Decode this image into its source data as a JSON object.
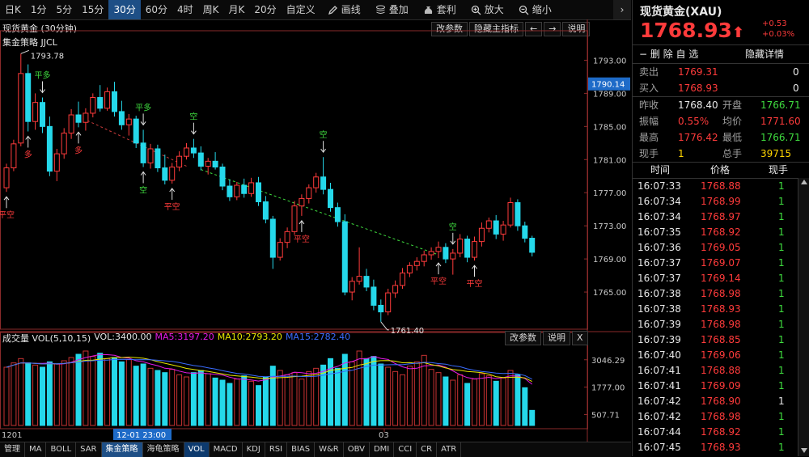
{
  "toolbar": {
    "periods": [
      "日K",
      "1分",
      "5分",
      "15分",
      "30分",
      "60分",
      "4时",
      "周K",
      "月K",
      "20分",
      "自定义"
    ],
    "active_period": "30分",
    "tools": [
      {
        "label": "画线",
        "icon": "pencil-icon"
      },
      {
        "label": "叠加",
        "icon": "stack-icon"
      },
      {
        "label": "套利",
        "icon": "money-bag-icon"
      },
      {
        "label": "放大",
        "icon": "zoom-in-icon"
      },
      {
        "label": "缩小",
        "icon": "zoom-out-icon"
      }
    ],
    "collapse": "›"
  },
  "chart_header": {
    "title": "现货黄金 (30分钟)",
    "strategy": "集金策略 JJCL",
    "buttons": [
      "改参数",
      "隐藏主指标",
      "←",
      "→",
      "说明"
    ]
  },
  "price_axis": {
    "ticks": [
      "1793.00",
      "1789.00",
      "1785.00",
      "1781.00",
      "1777.00",
      "1773.00",
      "1769.00",
      "1765.00"
    ],
    "current": "1790.14"
  },
  "annotations": {
    "high": "1793.78",
    "low": "1761.40"
  },
  "chart_data": [
    {
      "type": "candlestick",
      "title": "现货黄金 (30分钟)",
      "ylim": [
        1761,
        1795
      ],
      "x_labels": [
        "1201",
        "12-01 23:00",
        "03"
      ],
      "candles": [
        [
          1777.6,
          1780.5,
          1777.1,
          1780.0
        ],
        [
          1780.0,
          1783.4,
          1779.6,
          1782.9
        ],
        [
          1783.0,
          1793.8,
          1782.6,
          1791.4
        ],
        [
          1791.4,
          1792.5,
          1784.4,
          1785.6
        ],
        [
          1785.6,
          1789.0,
          1784.6,
          1787.9
        ],
        [
          1787.9,
          1788.5,
          1784.2,
          1785.0
        ],
        [
          1785.0,
          1786.2,
          1779.0,
          1779.6
        ],
        [
          1779.6,
          1782.3,
          1778.4,
          1781.7
        ],
        [
          1781.7,
          1784.8,
          1781.1,
          1784.2
        ],
        [
          1784.2,
          1787.1,
          1783.5,
          1786.4
        ],
        [
          1786.4,
          1788.0,
          1784.9,
          1785.5
        ],
        [
          1785.5,
          1787.2,
          1784.5,
          1786.6
        ],
        [
          1786.6,
          1789.0,
          1786.1,
          1788.5
        ],
        [
          1788.5,
          1790.0,
          1786.8,
          1787.2
        ],
        [
          1787.2,
          1789.7,
          1786.9,
          1789.2
        ],
        [
          1789.2,
          1790.4,
          1786.2,
          1786.8
        ],
        [
          1786.8,
          1788.1,
          1784.6,
          1785.2
        ],
        [
          1785.2,
          1786.5,
          1783.9,
          1785.9
        ],
        [
          1785.9,
          1786.3,
          1782.4,
          1783.0
        ],
        [
          1783.0,
          1784.6,
          1780.1,
          1780.6
        ],
        [
          1780.6,
          1782.9,
          1779.9,
          1782.3
        ],
        [
          1782.3,
          1782.8,
          1779.5,
          1780.0
        ],
        [
          1780.0,
          1781.6,
          1778.0,
          1778.5
        ],
        [
          1778.5,
          1780.6,
          1778.1,
          1780.1
        ],
        [
          1780.1,
          1782.0,
          1779.6,
          1781.4
        ],
        [
          1781.4,
          1783.0,
          1781.0,
          1782.4
        ],
        [
          1782.4,
          1783.5,
          1781.2,
          1781.8
        ],
        [
          1781.8,
          1782.6,
          1779.7,
          1780.2
        ],
        [
          1780.2,
          1781.2,
          1779.2,
          1780.8
        ],
        [
          1780.8,
          1781.9,
          1779.8,
          1780.1
        ],
        [
          1780.1,
          1780.5,
          1777.3,
          1777.8
        ],
        [
          1777.8,
          1778.6,
          1776.0,
          1776.5
        ],
        [
          1776.5,
          1778.3,
          1776.1,
          1777.9
        ],
        [
          1777.9,
          1778.7,
          1776.4,
          1776.9
        ],
        [
          1776.9,
          1778.8,
          1776.5,
          1778.2
        ],
        [
          1778.2,
          1778.9,
          1775.4,
          1775.9
        ],
        [
          1775.9,
          1776.6,
          1773.3,
          1773.8
        ],
        [
          1773.8,
          1774.2,
          1767.8,
          1769.2
        ],
        [
          1769.2,
          1771.5,
          1768.8,
          1771.0
        ],
        [
          1771.0,
          1772.8,
          1770.3,
          1772.3
        ],
        [
          1772.3,
          1776.0,
          1771.9,
          1775.4
        ],
        [
          1775.4,
          1776.8,
          1774.2,
          1776.3
        ],
        [
          1776.3,
          1778.0,
          1775.7,
          1777.6
        ],
        [
          1777.6,
          1779.4,
          1777.0,
          1778.9
        ],
        [
          1778.9,
          1781.3,
          1776.8,
          1777.4
        ],
        [
          1777.4,
          1778.2,
          1774.7,
          1775.2
        ],
        [
          1775.2,
          1775.8,
          1772.9,
          1773.5
        ],
        [
          1773.5,
          1774.4,
          1764.6,
          1765.0
        ],
        [
          1765.0,
          1766.8,
          1764.0,
          1766.3
        ],
        [
          1766.3,
          1770.4,
          1765.9,
          1766.9
        ],
        [
          1766.9,
          1767.8,
          1765.1,
          1765.6
        ],
        [
          1765.6,
          1766.5,
          1762.8,
          1763.4
        ],
        [
          1763.4,
          1764.1,
          1761.4,
          1762.6
        ],
        [
          1762.6,
          1765.4,
          1762.2,
          1764.9
        ],
        [
          1764.9,
          1766.4,
          1764.3,
          1765.8
        ],
        [
          1765.8,
          1767.9,
          1765.4,
          1767.3
        ],
        [
          1767.3,
          1768.6,
          1766.8,
          1768.2
        ],
        [
          1768.2,
          1769.2,
          1767.6,
          1768.7
        ],
        [
          1768.7,
          1770.0,
          1768.1,
          1769.5
        ],
        [
          1769.5,
          1770.4,
          1768.9,
          1769.9
        ],
        [
          1769.9,
          1771.1,
          1769.1,
          1770.4
        ],
        [
          1770.4,
          1770.9,
          1768.5,
          1769.0
        ],
        [
          1769.0,
          1770.2,
          1767.1,
          1769.7
        ],
        [
          1769.7,
          1772.0,
          1769.2,
          1771.4
        ],
        [
          1771.4,
          1771.8,
          1768.6,
          1769.2
        ],
        [
          1769.2,
          1771.7,
          1768.8,
          1771.1
        ],
        [
          1771.1,
          1773.4,
          1770.5,
          1772.7
        ],
        [
          1772.7,
          1774.0,
          1772.2,
          1773.6
        ],
        [
          1773.6,
          1774.3,
          1771.4,
          1772.0
        ],
        [
          1772.0,
          1773.6,
          1771.2,
          1773.1
        ],
        [
          1773.1,
          1776.4,
          1772.8,
          1775.8
        ],
        [
          1775.8,
          1776.2,
          1772.4,
          1773.0
        ],
        [
          1773.0,
          1773.5,
          1771.0,
          1771.5
        ],
        [
          1771.5,
          1771.8,
          1769.3,
          1769.8
        ]
      ],
      "markers": [
        {
          "i": 0,
          "text": "平空",
          "pos": "below",
          "color": "#ff3b3b"
        },
        {
          "i": 3,
          "text": "多",
          "pos": "below",
          "color": "#ff3b3b"
        },
        {
          "i": 5,
          "text": "平多",
          "pos": "above",
          "color": "#3fdc3f"
        },
        {
          "i": 10,
          "text": "多",
          "pos": "below",
          "color": "#ff3b3b"
        },
        {
          "i": 19,
          "text": "平多",
          "pos": "above",
          "color": "#3fdc3f"
        },
        {
          "i": 19,
          "text": "空",
          "pos": "below",
          "color": "#3fdc3f"
        },
        {
          "i": 23,
          "text": "平空",
          "pos": "below",
          "color": "#ff3b3b"
        },
        {
          "i": 26,
          "text": "空",
          "pos": "above",
          "color": "#3fdc3f"
        },
        {
          "i": 41,
          "text": "平空",
          "pos": "below",
          "color": "#ff3b3b"
        },
        {
          "i": 44,
          "text": "空",
          "pos": "above",
          "color": "#3fdc3f"
        },
        {
          "i": 60,
          "text": "平空",
          "pos": "below",
          "color": "#ff3b3b"
        },
        {
          "i": 62,
          "text": "空",
          "pos": "above",
          "color": "#3fdc3f"
        },
        {
          "i": 65,
          "text": "平空",
          "pos": "below",
          "color": "#ff3b3b"
        }
      ],
      "trendlines": [
        {
          "from": [
            10,
            1786.2
          ],
          "to": [
            25,
            1780.2
          ]
        },
        {
          "from": [
            27,
            1779.8
          ],
          "to": [
            60,
            1769.5
          ]
        }
      ]
    },
    {
      "type": "bar",
      "title": "成交量 VOL(5,10,15)",
      "ylim": [
        0,
        3600
      ],
      "y_ticks": [
        "3046.29",
        "1777.00",
        "507.71"
      ],
      "values": [
        2700,
        2900,
        3100,
        2900,
        2800,
        2700,
        2950,
        2850,
        3000,
        3150,
        3300,
        3450,
        3200,
        3350,
        3100,
        3150,
        2950,
        3050,
        2750,
        2850,
        2650,
        2550,
        2450,
        2600,
        2350,
        2250,
        2450,
        2550,
        2400,
        2200,
        2100,
        1950,
        2150,
        2300,
        2050,
        1850,
        2250,
        2750,
        2550,
        2350,
        2450,
        2150,
        2500,
        2650,
        2800,
        3100,
        2650,
        3300,
        2950,
        3450,
        3100,
        3200,
        2850,
        2700,
        2500,
        2350,
        2750,
        2950,
        3250,
        2600,
        2450,
        2250,
        2100,
        2350,
        1950,
        2150,
        2400,
        2300,
        2050,
        2200,
        2550,
        2350,
        1750,
        700
      ],
      "ma": [
        {
          "name": "MA5",
          "value": "3197.20",
          "color": "#e61ae6"
        },
        {
          "name": "MA10",
          "value": "2793.20",
          "color": "#e6e600"
        },
        {
          "name": "MA15",
          "value": "2782.40",
          "color": "#3a6cff"
        }
      ],
      "vol_value": "VOL:3400.00",
      "buttons": [
        "改参数",
        "说明",
        "X"
      ]
    }
  ],
  "tabs": {
    "items": [
      "管理",
      "MA",
      "BOLL",
      "SAR",
      "集金策略",
      "海龟策略",
      "VOL",
      "MACD",
      "KDJ",
      "RSI",
      "BIAS",
      "W&R",
      "OBV",
      "DMI",
      "CCI",
      "CR",
      "ATR"
    ],
    "active": "集金策略",
    "selected": "VOL"
  },
  "quote": {
    "name": "现货黄金(XAU)",
    "price": "1768.93",
    "change": "+0.53",
    "change_pct": "+0.03%",
    "delete_label": "删 除 自 选",
    "hide_label": "隐藏详情",
    "ask_label": "卖出",
    "ask_price": "1769.31",
    "ask_vol": "0",
    "bid_label": "买入",
    "bid_price": "1768.93",
    "bid_vol": "0",
    "fields": [
      {
        "l1": "昨收",
        "v1": "1768.40",
        "c1": "white",
        "l2": "开盘",
        "v2": "1766.71",
        "c2": "green"
      },
      {
        "l1": "振幅",
        "v1": "0.55%",
        "c1": "red",
        "l2": "均价",
        "v2": "1771.60",
        "c2": "red"
      },
      {
        "l1": "最高",
        "v1": "1776.42",
        "c1": "red",
        "l2": "最低",
        "v2": "1766.71",
        "c2": "green"
      },
      {
        "l1": "现手",
        "v1": "1",
        "c1": "yellow",
        "l2": "总手",
        "v2": "39715",
        "c2": "yellow"
      }
    ]
  },
  "ticks": {
    "headers": [
      "时间",
      "价格",
      "现手"
    ],
    "rows": [
      [
        "16:07:33",
        "1768.88",
        "1"
      ],
      [
        "16:07:34",
        "1768.99",
        "1"
      ],
      [
        "16:07:34",
        "1768.97",
        "1"
      ],
      [
        "16:07:35",
        "1768.92",
        "1"
      ],
      [
        "16:07:36",
        "1769.05",
        "1"
      ],
      [
        "16:07:37",
        "1769.07",
        "1"
      ],
      [
        "16:07:37",
        "1769.14",
        "1"
      ],
      [
        "16:07:38",
        "1768.98",
        "1"
      ],
      [
        "16:07:38",
        "1768.93",
        "1"
      ],
      [
        "16:07:39",
        "1768.98",
        "1"
      ],
      [
        "16:07:39",
        "1768.85",
        "1"
      ],
      [
        "16:07:40",
        "1769.06",
        "1"
      ],
      [
        "16:07:41",
        "1768.88",
        "1"
      ],
      [
        "16:07:41",
        "1769.09",
        "1"
      ],
      [
        "16:07:42",
        "1768.90",
        "1"
      ],
      [
        "16:07:42",
        "1768.98",
        "1"
      ],
      [
        "16:07:44",
        "1768.92",
        "1"
      ],
      [
        "16:07:45",
        "1768.93",
        "1"
      ]
    ]
  }
}
